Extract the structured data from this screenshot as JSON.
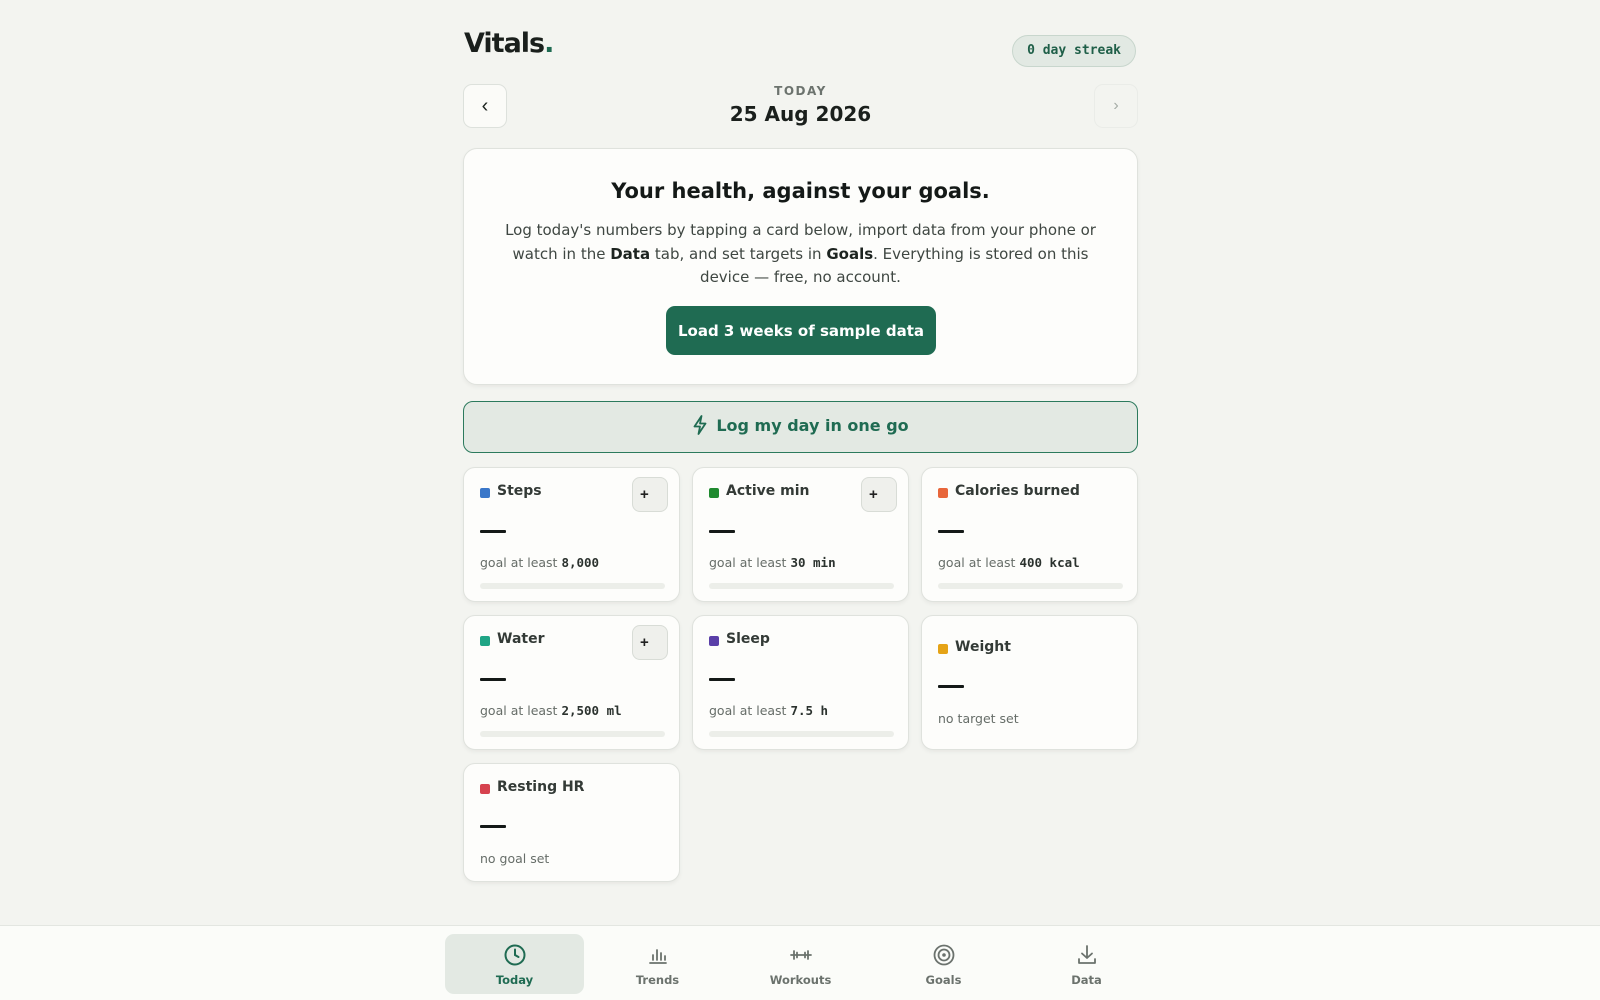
{
  "app": {
    "logo_text": "Vitals",
    "logo_dot": ".",
    "streak": "0 day streak"
  },
  "date": {
    "label": "TODAY",
    "value": "25 Aug 2026",
    "prev": "‹",
    "next": "›"
  },
  "intro": {
    "title": "Your health, against your goals.",
    "body_1": "Log today's numbers by tapping a card below, import data from your phone or watch in the ",
    "body_data": "Data",
    "body_2": " tab, and set targets in ",
    "body_goals": "Goals",
    "body_3": ". Everything is stored on this device — free, no account.",
    "sample_button": "Load 3 weeks of sample data"
  },
  "log_day": {
    "label": "Log my day in one go",
    "icon": "lightning-icon"
  },
  "metrics": [
    {
      "name": "Steps",
      "color": "#3a77c9",
      "value": "—",
      "goal_prefix": "goal at least ",
      "goal_value": "8,000",
      "progress": 0,
      "has_add": true,
      "add_label": "+"
    },
    {
      "name": "Active min",
      "color": "#1f8a2f",
      "value": "—",
      "goal_prefix": "goal at least ",
      "goal_value": "30 min",
      "progress": 0,
      "has_add": true,
      "add_label": "+"
    },
    {
      "name": "Calories burned",
      "color": "#e8663a",
      "value": "—",
      "goal_prefix": "goal at least ",
      "goal_value": "400 kcal",
      "progress": 0,
      "has_add": false
    },
    {
      "name": "Water",
      "color": "#1fa585",
      "value": "—",
      "goal_prefix": "goal at least ",
      "goal_value": "2,500 ml",
      "progress": 0,
      "has_add": true,
      "add_label": "+"
    },
    {
      "name": "Sleep",
      "color": "#5a3fa8",
      "value": "—",
      "goal_prefix": "goal at least ",
      "goal_value": "7.5 h",
      "progress": 0,
      "has_add": false
    },
    {
      "name": "Weight",
      "color": "#e5a316",
      "value": "—",
      "goal_text": "no target set",
      "has_add": false
    },
    {
      "name": "Resting HR",
      "color": "#d6424e",
      "value": "—",
      "goal_text": "no goal set",
      "has_add": false
    }
  ],
  "tabs": [
    {
      "label": "Today",
      "icon": "clock-icon",
      "active": true
    },
    {
      "label": "Trends",
      "icon": "bar-chart-icon",
      "active": false
    },
    {
      "label": "Workouts",
      "icon": "dumbbell-icon",
      "active": false
    },
    {
      "label": "Goals",
      "icon": "target-icon",
      "active": false
    },
    {
      "label": "Data",
      "icon": "download-icon",
      "active": false
    }
  ]
}
